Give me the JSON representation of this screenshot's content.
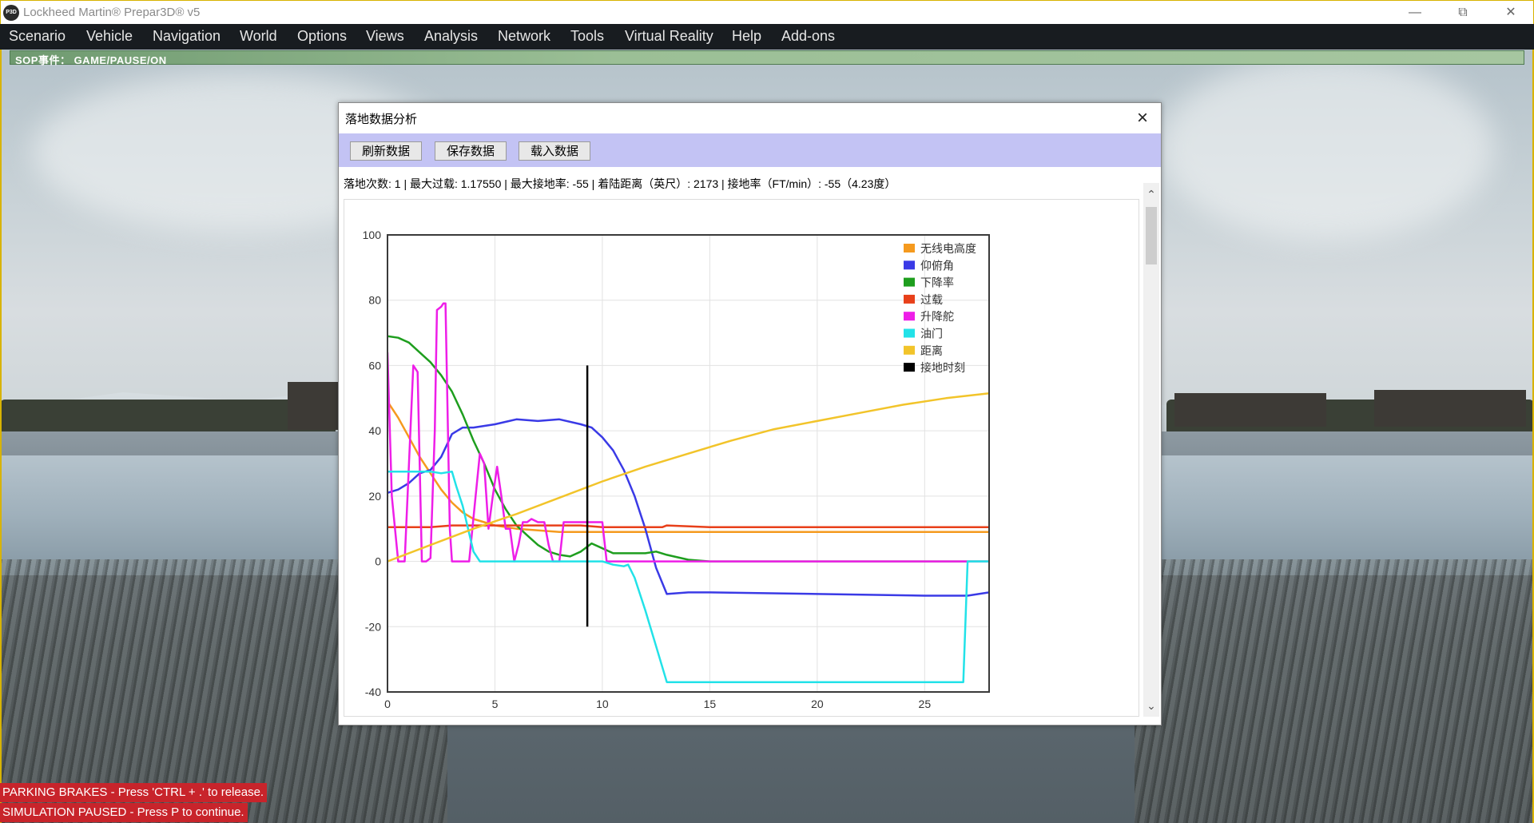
{
  "app": {
    "title": "Lockheed Martin® Prepar3D® v5",
    "icon": "P3D"
  },
  "window_controls": [
    "minimize-icon",
    "restore-icon",
    "close-icon"
  ],
  "menu": [
    {
      "label": "Scenario"
    },
    {
      "label": "Vehicle"
    },
    {
      "label": "Navigation"
    },
    {
      "label": "World"
    },
    {
      "label": "Options"
    },
    {
      "label": "Views"
    },
    {
      "label": "Analysis"
    },
    {
      "label": "Network"
    },
    {
      "label": "Tools"
    },
    {
      "label": "Virtual Reality"
    },
    {
      "label": "Help"
    },
    {
      "label": "Add-ons"
    }
  ],
  "sop_event": "SOP事件： GAME/PAUSE/ON",
  "status_messages": [
    "PARKING BRAKES - Press 'CTRL + .' to release.",
    "SIMULATION PAUSED - Press P to continue."
  ],
  "dialog": {
    "title": "落地数据分析",
    "buttons": [
      "刷新数据",
      "保存数据",
      "载入数据"
    ],
    "info": "落地次数: 1 | 最大过载: 1.17550 | 最大接地率: -55 | 着陆距离（英尺）: 2173 | 接地率（FT/min）: -55（4.23度）"
  },
  "chart_data": {
    "type": "line",
    "xlim": [
      0,
      28
    ],
    "ylim": [
      -40,
      100
    ],
    "x_ticks": [
      "0",
      "5",
      "10",
      "15",
      "20",
      "25"
    ],
    "y_ticks": [
      "100",
      "80",
      "60",
      "40",
      "20",
      "0",
      "-20",
      "-40"
    ],
    "grid": true,
    "legend_position": "top-right",
    "series": [
      {
        "name": "无线电高度",
        "color": "#f59a1e",
        "points": [
          [
            0,
            49
          ],
          [
            0.5,
            44
          ],
          [
            1,
            38
          ],
          [
            1.5,
            32
          ],
          [
            2,
            27
          ],
          [
            2.5,
            22
          ],
          [
            3,
            18
          ],
          [
            3.5,
            15
          ],
          [
            4,
            13
          ],
          [
            4.5,
            12
          ],
          [
            5,
            11
          ],
          [
            5.5,
            10.5
          ],
          [
            6,
            10
          ],
          [
            7,
            9.5
          ],
          [
            8,
            9
          ],
          [
            10,
            9
          ],
          [
            15,
            9
          ],
          [
            20,
            9
          ],
          [
            25,
            9
          ],
          [
            28,
            9
          ]
        ]
      },
      {
        "name": "仰俯角",
        "color": "#3a3ae6",
        "points": [
          [
            0,
            21
          ],
          [
            0.5,
            22
          ],
          [
            1,
            24
          ],
          [
            1.5,
            27
          ],
          [
            2,
            28
          ],
          [
            2.5,
            32
          ],
          [
            3,
            39
          ],
          [
            3.5,
            41
          ],
          [
            4,
            41
          ],
          [
            5,
            42
          ],
          [
            6,
            43.5
          ],
          [
            7,
            43
          ],
          [
            8,
            43.5
          ],
          [
            9,
            42
          ],
          [
            9.5,
            41
          ],
          [
            10,
            38
          ],
          [
            10.5,
            34
          ],
          [
            11,
            28
          ],
          [
            11.5,
            20
          ],
          [
            12,
            10
          ],
          [
            12.5,
            -2
          ],
          [
            13,
            -10
          ],
          [
            14,
            -9.5
          ],
          [
            15,
            -9.5
          ],
          [
            20,
            -10
          ],
          [
            25,
            -10.5
          ],
          [
            27,
            -10.5
          ],
          [
            28,
            -9.5
          ]
        ]
      },
      {
        "name": "下降率",
        "color": "#1e9e1e",
        "points": [
          [
            0,
            69
          ],
          [
            0.5,
            68.5
          ],
          [
            1,
            67
          ],
          [
            1.5,
            64
          ],
          [
            2,
            61
          ],
          [
            2.5,
            57
          ],
          [
            3,
            52
          ],
          [
            3.5,
            45
          ],
          [
            4,
            37
          ],
          [
            4.5,
            30
          ],
          [
            5,
            22
          ],
          [
            5.5,
            16
          ],
          [
            6,
            11
          ],
          [
            6.5,
            8
          ],
          [
            7,
            5
          ],
          [
            7.5,
            3
          ],
          [
            8,
            2
          ],
          [
            8.5,
            1.5
          ],
          [
            9,
            3
          ],
          [
            9.5,
            5.5
          ],
          [
            10,
            4
          ],
          [
            10.5,
            2.5
          ],
          [
            11,
            2.5
          ],
          [
            12,
            2.5
          ],
          [
            12.5,
            3
          ],
          [
            13,
            2
          ],
          [
            14,
            0.5
          ],
          [
            15,
            0
          ],
          [
            20,
            0
          ],
          [
            25,
            0
          ],
          [
            28,
            0
          ]
        ]
      },
      {
        "name": "过载",
        "color": "#e8401a",
        "points": [
          [
            0,
            10.5
          ],
          [
            1,
            10.5
          ],
          [
            2,
            10.5
          ],
          [
            3,
            11
          ],
          [
            4,
            11
          ],
          [
            5,
            11
          ],
          [
            6,
            11
          ],
          [
            7,
            11
          ],
          [
            8,
            11
          ],
          [
            9,
            11
          ],
          [
            10,
            10.5
          ],
          [
            11,
            10.5
          ],
          [
            12,
            10.5
          ],
          [
            12.8,
            10.5
          ],
          [
            13,
            11
          ],
          [
            15,
            10.5
          ],
          [
            20,
            10.5
          ],
          [
            25,
            10.5
          ],
          [
            28,
            10.5
          ]
        ]
      },
      {
        "name": "升降舵",
        "color": "#ee1ee8",
        "points": [
          [
            0,
            64
          ],
          [
            0.2,
            20
          ],
          [
            0.5,
            0
          ],
          [
            0.8,
            0
          ],
          [
            1,
            30
          ],
          [
            1.2,
            60
          ],
          [
            1.4,
            58
          ],
          [
            1.6,
            0
          ],
          [
            1.8,
            0
          ],
          [
            2,
            1
          ],
          [
            2.2,
            40
          ],
          [
            2.3,
            77
          ],
          [
            2.5,
            78
          ],
          [
            2.6,
            79
          ],
          [
            2.7,
            79
          ],
          [
            2.9,
            10
          ],
          [
            3,
            0
          ],
          [
            3.5,
            0
          ],
          [
            3.8,
            0
          ],
          [
            4.1,
            20
          ],
          [
            4.3,
            33
          ],
          [
            4.5,
            30
          ],
          [
            4.7,
            10
          ],
          [
            4.9,
            20
          ],
          [
            5.1,
            29
          ],
          [
            5.3,
            20
          ],
          [
            5.5,
            10
          ],
          [
            5.7,
            10
          ],
          [
            5.9,
            0
          ],
          [
            6.1,
            5
          ],
          [
            6.3,
            12
          ],
          [
            6.5,
            12
          ],
          [
            6.7,
            13
          ],
          [
            7,
            12
          ],
          [
            7.3,
            12
          ],
          [
            7.5,
            5
          ],
          [
            7.7,
            0
          ],
          [
            8,
            0
          ],
          [
            8.2,
            12
          ],
          [
            8.5,
            12
          ],
          [
            9,
            12
          ],
          [
            9.5,
            12
          ],
          [
            10,
            12
          ],
          [
            10.2,
            0
          ],
          [
            11,
            0
          ],
          [
            12,
            0
          ],
          [
            15,
            0
          ],
          [
            20,
            0
          ],
          [
            25,
            0
          ],
          [
            28,
            0
          ]
        ]
      },
      {
        "name": "油门",
        "color": "#22e2e8",
        "points": [
          [
            0,
            27.5
          ],
          [
            0.5,
            27.5
          ],
          [
            1,
            27.5
          ],
          [
            1.5,
            27.5
          ],
          [
            2,
            27.5
          ],
          [
            2.5,
            27
          ],
          [
            3,
            27.5
          ],
          [
            3.2,
            23
          ],
          [
            3.5,
            17
          ],
          [
            4,
            3
          ],
          [
            4.3,
            0
          ],
          [
            5,
            0
          ],
          [
            10,
            0
          ],
          [
            10.5,
            -1
          ],
          [
            11,
            -1.5
          ],
          [
            11.2,
            -1
          ],
          [
            11.5,
            -5
          ],
          [
            12,
            -15
          ],
          [
            12.5,
            -26
          ],
          [
            13,
            -37
          ],
          [
            15,
            -37
          ],
          [
            20,
            -37
          ],
          [
            25,
            -37
          ],
          [
            26.8,
            -37
          ],
          [
            27,
            0
          ],
          [
            28,
            0
          ]
        ]
      },
      {
        "name": "距离",
        "color": "#f2c42a",
        "points": [
          [
            0,
            0
          ],
          [
            2,
            5
          ],
          [
            4,
            10
          ],
          [
            6,
            14.5
          ],
          [
            8,
            19.5
          ],
          [
            10,
            24.5
          ],
          [
            12,
            29
          ],
          [
            14,
            33
          ],
          [
            16,
            37
          ],
          [
            18,
            40.5
          ],
          [
            20,
            43
          ],
          [
            22,
            45.5
          ],
          [
            24,
            48
          ],
          [
            26,
            50
          ],
          [
            28,
            51.5
          ]
        ]
      },
      {
        "name": "接地时刻",
        "color": "#000000",
        "points": [
          [
            9.3,
            60
          ],
          [
            9.3,
            -20
          ]
        ]
      }
    ]
  }
}
